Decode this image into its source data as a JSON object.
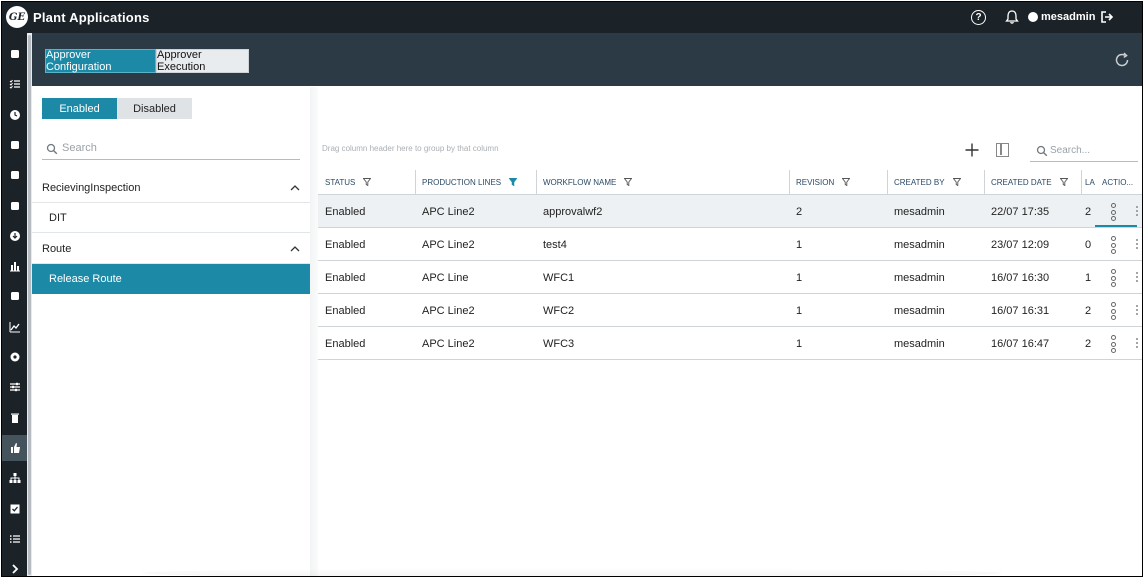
{
  "app": {
    "title": "Plant Applications",
    "logo_text": "GE"
  },
  "topbar": {
    "user_name": "mesadmin",
    "help_glyph": "?"
  },
  "leftnav": {
    "items": [
      {
        "icon": "operator-icon"
      },
      {
        "icon": "checklist-icon"
      },
      {
        "icon": "clock-icon"
      },
      {
        "icon": "list-card-icon"
      },
      {
        "icon": "gears-icon"
      },
      {
        "icon": "edit-icon"
      },
      {
        "icon": "download-icon"
      },
      {
        "icon": "bar-chart-icon"
      },
      {
        "icon": "calculator-icon"
      },
      {
        "icon": "line-chart-icon"
      },
      {
        "icon": "settings-icon"
      },
      {
        "icon": "sliders-icon"
      },
      {
        "icon": "trash-icon"
      },
      {
        "icon": "thumbs-up-icon",
        "active": true
      },
      {
        "icon": "hierarchy-icon"
      },
      {
        "icon": "checkbox-icon"
      },
      {
        "icon": "bullet-list-icon"
      },
      {
        "icon": "expand-chevron-icon"
      }
    ]
  },
  "tabs": {
    "approver_configuration": "Approver Configuration",
    "approver_execution": "Approver Execution",
    "active": "approver_configuration"
  },
  "toggle": {
    "enabled": "Enabled",
    "disabled": "Disabled",
    "active": "enabled"
  },
  "left_panel": {
    "search_placeholder": "Search",
    "groups": [
      {
        "label": "RecievingInspection",
        "expanded": true,
        "items": [
          {
            "label": "DIT",
            "selected": false
          }
        ]
      },
      {
        "label": "Route",
        "expanded": true,
        "items": [
          {
            "label": "Release Route",
            "selected": true
          }
        ]
      }
    ]
  },
  "grid": {
    "group_hint": "Drag column header here to group by that column",
    "search_placeholder": "Search...",
    "columns": [
      "STATUS",
      "PRODUCTION LINES",
      "WORKFLOW NAME",
      "REVISION",
      "CREATED BY",
      "CREATED DATE",
      "LA",
      "ACTIO..."
    ],
    "active_filter_column": "PRODUCTION LINES",
    "rows": [
      {
        "status": "Enabled",
        "line": "APC Line2",
        "workflow": "approvalwf2",
        "revision": "2",
        "created_by": "mesadmin",
        "created_date": "22/07 17:35",
        "last": "2"
      },
      {
        "status": "Enabled",
        "line": "APC Line2",
        "workflow": "test4",
        "revision": "1",
        "created_by": "mesadmin",
        "created_date": "23/07 12:09",
        "last": "0"
      },
      {
        "status": "Enabled",
        "line": "APC Line",
        "workflow": "WFC1",
        "revision": "1",
        "created_by": "mesadmin",
        "created_date": "16/07 16:30",
        "last": "1"
      },
      {
        "status": "Enabled",
        "line": "APC Line2",
        "workflow": "WFC2",
        "revision": "1",
        "created_by": "mesadmin",
        "created_date": "16/07 16:31",
        "last": "2"
      },
      {
        "status": "Enabled",
        "line": "APC Line2",
        "workflow": "WFC3",
        "revision": "1",
        "created_by": "mesadmin",
        "created_date": "16/07 16:47",
        "last": "2"
      }
    ]
  },
  "colors": {
    "accent": "#1c8aa6",
    "topbar": "#1b2228",
    "header": "#2b3a44",
    "nav_active": "#45535d"
  }
}
